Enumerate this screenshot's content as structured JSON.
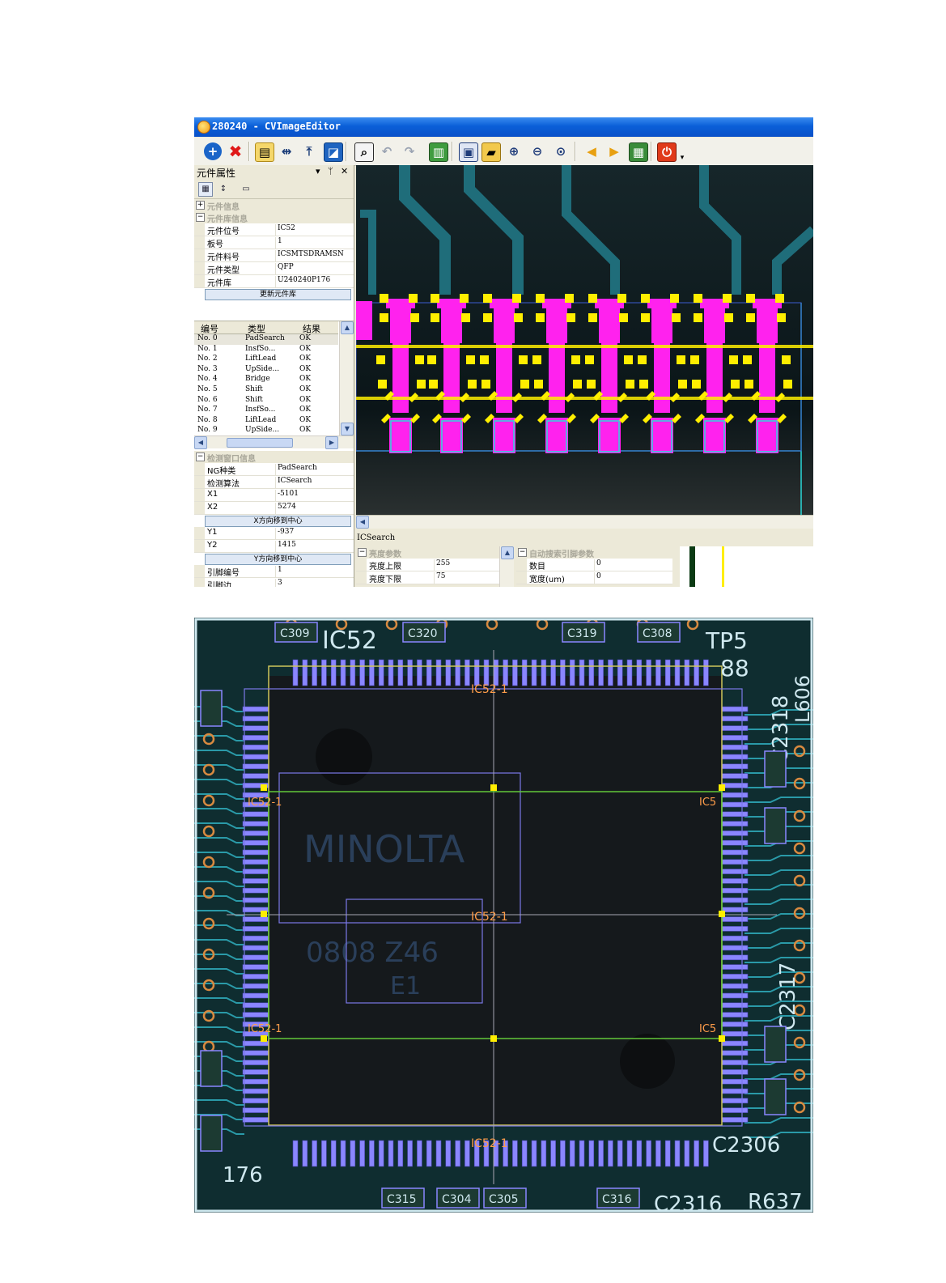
{
  "window": {
    "title": "280240 - CVImageEditor"
  },
  "toolbar": {
    "icons": [
      "add-icon",
      "delete-icon",
      "open-book-icon",
      "fit-width-icon",
      "fit-height-icon",
      "select-region-icon",
      "zoom-window-icon",
      "undo-icon",
      "redo-icon",
      "library-icon",
      "save-icon",
      "open-folder-icon",
      "zoom-in-icon",
      "zoom-out-icon",
      "zoom-fit-icon",
      "arrow-left-icon",
      "arrow-right-icon",
      "notebook-icon",
      "power-icon"
    ]
  },
  "panel": {
    "title": "元件属性",
    "pin": "▾ ᛘ ✕"
  },
  "component_info": {
    "category_1": "元件信息",
    "category_2": "元件库信息",
    "rows": [
      {
        "k": "元件位号",
        "v": "IC52"
      },
      {
        "k": "板号",
        "v": "1"
      },
      {
        "k": "元件料号",
        "v": "ICSMTSDRAMSN"
      },
      {
        "k": "元件类型",
        "v": "QFP"
      },
      {
        "k": "元件库",
        "v": "U240240P176"
      }
    ],
    "update_button": "更新元件库"
  },
  "results": {
    "headers": [
      "编号",
      "类型",
      "结果"
    ],
    "rows": [
      {
        "no": "No. 0",
        "type": "PadSearch",
        "res": "OK"
      },
      {
        "no": "No. 1",
        "type": "InsfSo...",
        "res": "OK"
      },
      {
        "no": "No. 2",
        "type": "LiftLead",
        "res": "OK"
      },
      {
        "no": "No. 3",
        "type": "UpSide...",
        "res": "OK"
      },
      {
        "no": "No. 4",
        "type": "Bridge",
        "res": "OK"
      },
      {
        "no": "No. 5",
        "type": "Shift",
        "res": "OK"
      },
      {
        "no": "No. 6",
        "type": "Shift",
        "res": "OK"
      },
      {
        "no": "No. 7",
        "type": "InsfSo...",
        "res": "OK"
      },
      {
        "no": "No. 8",
        "type": "LiftLead",
        "res": "OK"
      },
      {
        "no": "No. 9",
        "type": "UpSide...",
        "res": "OK"
      }
    ]
  },
  "detect_window": {
    "category": "检测窗口信息",
    "rows_a": [
      {
        "k": "NG种类",
        "v": "PadSearch"
      },
      {
        "k": "检测算法",
        "v": "ICSearch"
      },
      {
        "k": "X1",
        "v": "-5101"
      },
      {
        "k": "X2",
        "v": "5274"
      }
    ],
    "x_button": "X方向移到中心",
    "rows_b": [
      {
        "k": "Y1",
        "v": "-937"
      },
      {
        "k": "Y2",
        "v": "1415"
      }
    ],
    "y_button": "Y方向移到中心",
    "rows_c": [
      {
        "k": "引脚编号",
        "v": "1"
      },
      {
        "k": "引脚边",
        "v": "3"
      }
    ]
  },
  "icsearch": {
    "title": "ICSearch",
    "brightness_category": "亮度参数",
    "brightness_rows": [
      {
        "k": "亮度上限",
        "v": "255"
      },
      {
        "k": "亮度下限",
        "v": "75"
      }
    ],
    "auto_category": "自动搜索引脚参数",
    "auto_rows": [
      {
        "k": "数目",
        "v": "0"
      },
      {
        "k": "宽度(um)",
        "v": "0"
      }
    ]
  },
  "pcb": {
    "labels": {
      "ic52_silk": "IC52",
      "tp5": "TP5",
      "n88": "88",
      "n176": "176",
      "c2318": "C2318",
      "c2317": "C2317",
      "c2306": "C2306",
      "c2316": "C2316",
      "r637": "R637",
      "l606": "L606",
      "minolta": "MINOLTA",
      "date": "0808 Z46",
      "e1": "E1",
      "box_top": "IC52-1",
      "box_center": "IC52-1",
      "box_bottom": "IC52-1",
      "box_left_top": "IC52-1",
      "box_left_bottom": "IC52-1",
      "box_right_top": "IC5",
      "box_right_bottom": "IC5"
    },
    "parts": [
      "C309",
      "C320",
      "C319",
      "C308",
      "C315",
      "C304",
      "C305",
      "C316"
    ],
    "colors": {
      "lead": "#8a86ff",
      "outline": "#7b78e8",
      "green": "#63c83a",
      "yellow": "#ffee00",
      "silk": "#cfe8ef",
      "orange": "#ff9d4a"
    }
  },
  "colors": {
    "title_bar": "#0a5fd8",
    "pad_magenta": "#ff22ee",
    "pad_yellow": "#ffee00",
    "trace_cyan": "#2bd8d8"
  }
}
